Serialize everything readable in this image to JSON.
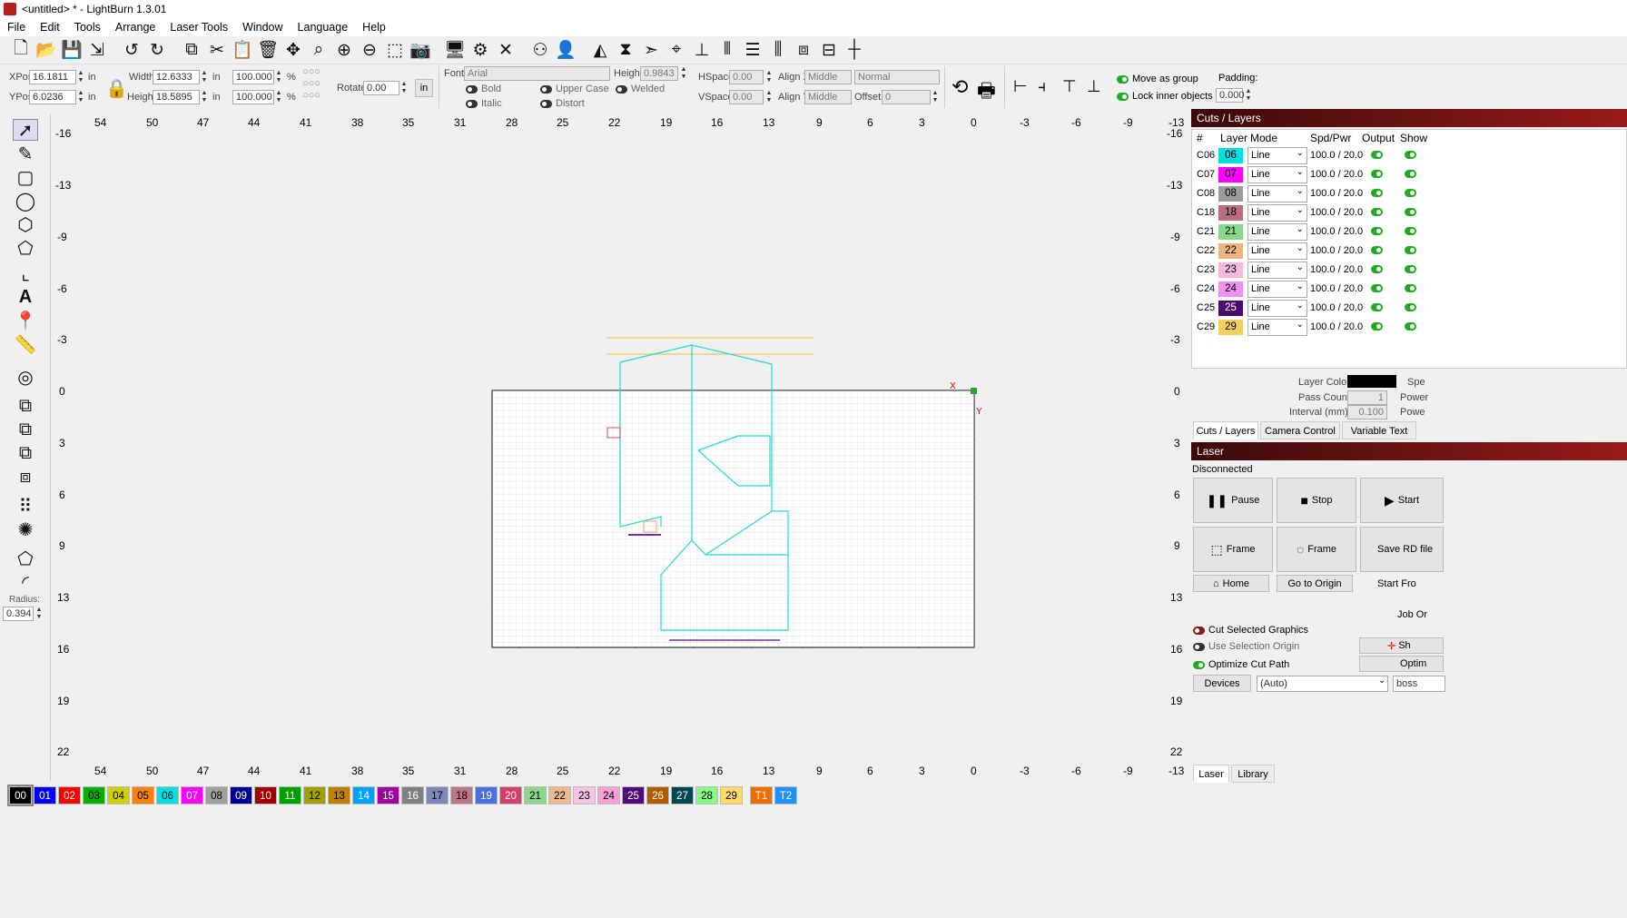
{
  "window": {
    "title": "<untitled> * - LightBurn 1.3.01"
  },
  "menu": [
    "File",
    "Edit",
    "Tools",
    "Arrange",
    "Laser Tools",
    "Window",
    "Language",
    "Help"
  ],
  "toolbar_icons": [
    "new-file-icon",
    "open-folder-icon",
    "save-icon",
    "import-icon",
    "undo-icon",
    "redo-icon",
    "copy-icon",
    "cut-icon",
    "paste-icon",
    "delete-icon",
    "move-icon",
    "zoom-frame-icon",
    "zoom-in-icon",
    "zoom-out-icon",
    "zoom-selection-icon",
    "camera-icon",
    "monitor-icon",
    "settings-icon",
    "tools-icon",
    "group-icon",
    "ungroup-icon",
    "mirror-h-icon",
    "mirror-v-icon",
    "send-icon",
    "target-icon",
    "align-icon",
    "align2-icon",
    "distribute-icon",
    "distribute2-icon",
    "flip-icon",
    "dock-icon",
    "crosshair-icon"
  ],
  "numeric": {
    "xpos_label": "XPos",
    "xpos": "16.1811",
    "ypos_label": "YPos",
    "ypos": "6.0236",
    "unit": "in",
    "width_label": "Width",
    "width": "12.6333",
    "height_label": "Height",
    "height": "18.5895",
    "scale_w": "100.000",
    "scale_h": "100.000",
    "pct": "%",
    "rotate_label": "Rotate",
    "rotate": "0.00",
    "in_btn": "in"
  },
  "text_tools": {
    "font_label": "Font",
    "font": "Arial",
    "height_label": "Height",
    "height": "0.9843",
    "hspace_label": "HSpace",
    "hspace": "0.00",
    "vspace_label": "VSpace",
    "vspace": "0.00",
    "alignx_label": "Align X",
    "alignx": "Middle",
    "aligny_label": "Align Y",
    "aligny": "Middle",
    "style": "Normal",
    "offset_label": "Offset",
    "offset": "0",
    "bold": "Bold",
    "italic": "Italic",
    "upper": "Upper Case",
    "distort": "Distort",
    "welded": "Welded"
  },
  "arrange": {
    "move_group": "Move as group",
    "lock_inner": "Lock inner objects",
    "padding_label": "Padding:",
    "padding": "0.000"
  },
  "ruler": {
    "top": [
      "54",
      "50",
      "47",
      "44",
      "41",
      "38",
      "35",
      "31",
      "28",
      "25",
      "22",
      "19",
      "16",
      "13",
      "9",
      "6",
      "3",
      "0",
      "-3",
      "-6",
      "-9",
      "-13"
    ],
    "side": [
      "-16",
      "-13",
      "-9",
      "-6",
      "-3",
      "0",
      "3",
      "6",
      "9",
      "13",
      "16",
      "19",
      "22"
    ]
  },
  "origin": {
    "x": "X",
    "y": "Y"
  },
  "left": {
    "radius_label": "Radius:",
    "radius": "0.394"
  },
  "cuts": {
    "title": "Cuts / Layers",
    "headers": [
      "#",
      "Layer",
      "Mode",
      "Spd/Pwr",
      "Output",
      "Show"
    ],
    "rows": [
      {
        "num": "C06",
        "layer": "06",
        "color": "#00e0e0",
        "mode": "Line",
        "sp": "100.0 / 20.0"
      },
      {
        "num": "C07",
        "layer": "07",
        "color": "#ff00ff",
        "mode": "Line",
        "sp": "100.0 / 20.0"
      },
      {
        "num": "C08",
        "layer": "08",
        "color": "#9c9c9c",
        "mode": "Line",
        "sp": "100.0 / 20.0"
      },
      {
        "num": "C18",
        "layer": "18",
        "color": "#b86e80",
        "mode": "Line",
        "sp": "100.0 / 20.0"
      },
      {
        "num": "C21",
        "layer": "21",
        "color": "#8ad98a",
        "mode": "Line",
        "sp": "100.0 / 20.0"
      },
      {
        "num": "C22",
        "layer": "22",
        "color": "#f0b480",
        "mode": "Line",
        "sp": "100.0 / 20.0"
      },
      {
        "num": "C23",
        "layer": "23",
        "color": "#f8b8e0",
        "mode": "Line",
        "sp": "100.0 / 20.0"
      },
      {
        "num": "C24",
        "layer": "24",
        "color": "#f090f0",
        "mode": "Line",
        "sp": "100.0 / 20.0"
      },
      {
        "num": "C25",
        "layer": "25",
        "color": "#4b0a6e",
        "mode": "Line",
        "sp": "100.0 / 20.0"
      },
      {
        "num": "C29",
        "layer": "29",
        "color": "#f5d060",
        "mode": "Line",
        "sp": "100.0 / 20.0"
      }
    ],
    "layer_color_label": "Layer Color",
    "pass_label": "Pass Count",
    "pass": "1",
    "interval_label": "Interval (mm)",
    "interval": "0.100",
    "spe": "Spe",
    "power": "Power",
    "powe": "Powe"
  },
  "tabs_mid": [
    "Cuts / Layers",
    "Camera Control",
    "Variable Text"
  ],
  "laser": {
    "title": "Laser",
    "status": "Disconnected",
    "pause": "Pause",
    "stop": "Stop",
    "start": "Start",
    "frame1": "Frame",
    "frame2": "Frame",
    "save_rd": "Save RD file",
    "home": "Home",
    "origin": "Go to Origin",
    "start_from": "Start Fro",
    "job_origin": "Job Or",
    "cut_selected": "Cut Selected Graphics",
    "use_sel_origin": "Use Selection Origin",
    "optimize": "Optimize Cut Path",
    "show_btn": "Sh",
    "optim_btn": "Optim",
    "devices": "Devices",
    "auto": "(Auto)",
    "device_name": "boss"
  },
  "tabs_bottom": [
    "Laser",
    "Library"
  ],
  "palette": [
    {
      "t": "00",
      "c": "#000000",
      "f": "#fff"
    },
    {
      "t": "01",
      "c": "#0000ff",
      "f": "#fff"
    },
    {
      "t": "02",
      "c": "#ff0000",
      "f": "#fff"
    },
    {
      "t": "03",
      "c": "#00b000",
      "f": "#000"
    },
    {
      "t": "04",
      "c": "#d0d000",
      "f": "#000"
    },
    {
      "t": "05",
      "c": "#ff8000",
      "f": "#000"
    },
    {
      "t": "06",
      "c": "#00e0e0",
      "f": "#000"
    },
    {
      "t": "07",
      "c": "#ff00ff",
      "f": "#fff"
    },
    {
      "t": "08",
      "c": "#a0a0a0",
      "f": "#000"
    },
    {
      "t": "09",
      "c": "#000090",
      "f": "#fff"
    },
    {
      "t": "10",
      "c": "#a00000",
      "f": "#fff"
    },
    {
      "t": "11",
      "c": "#00a000",
      "f": "#fff"
    },
    {
      "t": "12",
      "c": "#a0a000",
      "f": "#000"
    },
    {
      "t": "13",
      "c": "#c08000",
      "f": "#000"
    },
    {
      "t": "14",
      "c": "#00a0ff",
      "f": "#fff"
    },
    {
      "t": "15",
      "c": "#a000a0",
      "f": "#fff"
    },
    {
      "t": "16",
      "c": "#808080",
      "f": "#fff"
    },
    {
      "t": "17",
      "c": "#7d87b9",
      "f": "#000"
    },
    {
      "t": "18",
      "c": "#bb7784",
      "f": "#000"
    },
    {
      "t": "19",
      "c": "#4a6fe3",
      "f": "#fff"
    },
    {
      "t": "20",
      "c": "#d33f6a",
      "f": "#fff"
    },
    {
      "t": "21",
      "c": "#8cd78c",
      "f": "#000"
    },
    {
      "t": "22",
      "c": "#f0b98d",
      "f": "#000"
    },
    {
      "t": "23",
      "c": "#f6c4e1",
      "f": "#000"
    },
    {
      "t": "24",
      "c": "#fa9ed4",
      "f": "#000"
    },
    {
      "t": "25",
      "c": "#500a78",
      "f": "#fff"
    },
    {
      "t": "26",
      "c": "#b45a00",
      "f": "#fff"
    },
    {
      "t": "27",
      "c": "#004754",
      "f": "#fff"
    },
    {
      "t": "28",
      "c": "#86fa88",
      "f": "#000"
    },
    {
      "t": "29",
      "c": "#ffdb66",
      "f": "#000"
    },
    {
      "t": "T1",
      "c": "#f36c00",
      "f": "#fff"
    },
    {
      "t": "T2",
      "c": "#1e90ff",
      "f": "#fff"
    }
  ]
}
